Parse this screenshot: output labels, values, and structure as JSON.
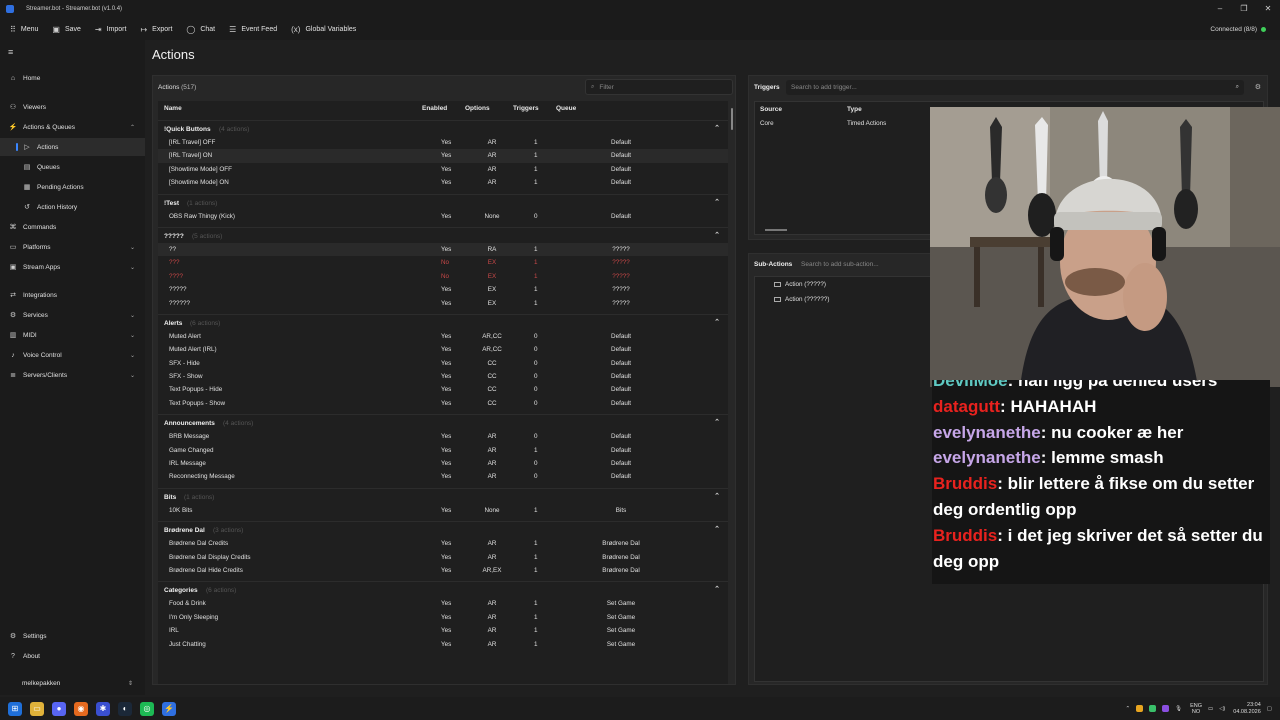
{
  "window": {
    "title": "Streamer.bot - Streamer.bot (v1.0.4)"
  },
  "toolbar": {
    "items": [
      {
        "label": "Menu",
        "icon": "grid-icon"
      },
      {
        "label": "Save",
        "icon": "save-icon"
      },
      {
        "label": "Import",
        "icon": "import-icon"
      },
      {
        "label": "Export",
        "icon": "export-icon"
      },
      {
        "label": "Chat",
        "icon": "chat-icon"
      },
      {
        "label": "Event Feed",
        "icon": "event-feed-icon"
      },
      {
        "label": "Global Variables",
        "icon": "variables-icon"
      }
    ],
    "connection": "Connected (8/8)",
    "connection_color": "#3fcf5a"
  },
  "sidebar": {
    "items": [
      {
        "label": "Home",
        "icon": "home-icon"
      },
      {
        "label": "Viewers",
        "icon": "viewers-icon"
      },
      {
        "label": "Actions & Queues",
        "icon": "actions-icon"
      },
      {
        "label": "Actions",
        "icon": "action-icon"
      },
      {
        "label": "Queues",
        "icon": "queues-icon"
      },
      {
        "label": "Pending Actions",
        "icon": "pending-icon"
      },
      {
        "label": "Action History",
        "icon": "history-icon"
      },
      {
        "label": "Commands",
        "icon": "commands-icon"
      },
      {
        "label": "Platforms",
        "icon": "platforms-icon"
      },
      {
        "label": "Stream Apps",
        "icon": "stream-apps-icon"
      },
      {
        "label": "Integrations",
        "icon": "integrations-icon"
      },
      {
        "label": "Services",
        "icon": "services-icon"
      },
      {
        "label": "MIDI",
        "icon": "midi-icon"
      },
      {
        "label": "Voice Control",
        "icon": "voice-icon"
      },
      {
        "label": "Servers/Clients",
        "icon": "servers-icon"
      },
      {
        "label": "Settings",
        "icon": "settings-icon"
      },
      {
        "label": "About",
        "icon": "about-icon"
      }
    ],
    "user": "melkepakken"
  },
  "page": {
    "title": "Actions"
  },
  "actions_panel": {
    "label": "Actions",
    "count": "(517)",
    "filter_placeholder": "Filter",
    "columns": [
      "Name",
      "Enabled",
      "Options",
      "Triggers",
      "Queue"
    ],
    "groups": [
      {
        "name": "!Quick Buttons",
        "count": "(4 actions)",
        "rows": [
          {
            "name": "[IRL Travel] OFF",
            "enabled": "Yes",
            "options": "AR",
            "triggers": "1",
            "queue": "Default"
          },
          {
            "name": "[IRL Travel] ON",
            "enabled": "Yes",
            "options": "AR",
            "triggers": "1",
            "queue": "Default"
          },
          {
            "name": "[Showtime Mode] OFF",
            "enabled": "Yes",
            "options": "AR",
            "triggers": "1",
            "queue": "Default"
          },
          {
            "name": "[Showtime Mode] ON",
            "enabled": "Yes",
            "options": "AR",
            "triggers": "1",
            "queue": "Default"
          }
        ]
      },
      {
        "name": "!Test",
        "count": "(1 actions)",
        "rows": [
          {
            "name": "OBS Raw Thingy (Kick)",
            "enabled": "Yes",
            "options": "None",
            "triggers": "0",
            "queue": "Default"
          }
        ]
      },
      {
        "name": "?????",
        "count": "(5 actions)",
        "rows": [
          {
            "name": "??",
            "enabled": "Yes",
            "options": "RA",
            "triggers": "1",
            "queue": "?????"
          },
          {
            "name": "???",
            "enabled": "No",
            "options": "EX",
            "triggers": "1",
            "queue": "?????"
          },
          {
            "name": "????",
            "enabled": "No",
            "options": "EX",
            "triggers": "1",
            "queue": "?????"
          },
          {
            "name": "?????",
            "enabled": "Yes",
            "options": "EX",
            "triggers": "1",
            "queue": "?????"
          },
          {
            "name": "??????",
            "enabled": "Yes",
            "options": "EX",
            "triggers": "1",
            "queue": "?????"
          }
        ]
      },
      {
        "name": "Alerts",
        "count": "(6 actions)",
        "rows": [
          {
            "name": "Muted Alert",
            "enabled": "Yes",
            "options": "AR,CC",
            "triggers": "0",
            "queue": "Default"
          },
          {
            "name": "Muted Alert (IRL)",
            "enabled": "Yes",
            "options": "AR,CC",
            "triggers": "0",
            "queue": "Default"
          },
          {
            "name": "SFX - Hide",
            "enabled": "Yes",
            "options": "CC",
            "triggers": "0",
            "queue": "Default"
          },
          {
            "name": "SFX - Show",
            "enabled": "Yes",
            "options": "CC",
            "triggers": "0",
            "queue": "Default"
          },
          {
            "name": "Text Popups - Hide",
            "enabled": "Yes",
            "options": "CC",
            "triggers": "0",
            "queue": "Default"
          },
          {
            "name": "Text Popups - Show",
            "enabled": "Yes",
            "options": "CC",
            "triggers": "0",
            "queue": "Default"
          }
        ]
      },
      {
        "name": "Announcements",
        "count": "(4 actions)",
        "rows": [
          {
            "name": "BRB Message",
            "enabled": "Yes",
            "options": "AR",
            "triggers": "0",
            "queue": "Default"
          },
          {
            "name": "Game Changed",
            "enabled": "Yes",
            "options": "AR",
            "triggers": "1",
            "queue": "Default"
          },
          {
            "name": "IRL Message",
            "enabled": "Yes",
            "options": "AR",
            "triggers": "0",
            "queue": "Default"
          },
          {
            "name": "Reconnecting Message",
            "enabled": "Yes",
            "options": "AR",
            "triggers": "0",
            "queue": "Default"
          }
        ]
      },
      {
        "name": "Bits",
        "count": "(1 actions)",
        "rows": [
          {
            "name": "10K Bits",
            "enabled": "Yes",
            "options": "None",
            "triggers": "1",
            "queue": "Bits"
          }
        ]
      },
      {
        "name": "Brødrene Dal",
        "count": "(3 actions)",
        "rows": [
          {
            "name": "Brødrene Dal Credits",
            "enabled": "Yes",
            "options": "AR",
            "triggers": "1",
            "queue": "Brødrene Dal"
          },
          {
            "name": "Brødrene Dal Display Credits",
            "enabled": "Yes",
            "options": "AR",
            "triggers": "1",
            "queue": "Brødrene Dal"
          },
          {
            "name": "Brødrene Dal Hide Credits",
            "enabled": "Yes",
            "options": "AR,EX",
            "triggers": "1",
            "queue": "Brødrene Dal"
          }
        ]
      },
      {
        "name": "Categories",
        "count": "(6 actions)",
        "rows": [
          {
            "name": "Food & Drink",
            "enabled": "Yes",
            "options": "AR",
            "triggers": "1",
            "queue": "Set Game"
          },
          {
            "name": "I'm Only Sleeping",
            "enabled": "Yes",
            "options": "AR",
            "triggers": "1",
            "queue": "Set Game"
          },
          {
            "name": "IRL",
            "enabled": "Yes",
            "options": "AR",
            "triggers": "1",
            "queue": "Set Game"
          },
          {
            "name": "Just Chatting",
            "enabled": "Yes",
            "options": "AR",
            "triggers": "1",
            "queue": "Set Game"
          }
        ]
      }
    ]
  },
  "triggers_panel": {
    "label": "Triggers",
    "search_placeholder": "Search to add trigger...",
    "columns": [
      "Source",
      "Type"
    ],
    "rows": [
      {
        "source": "Core",
        "type": "Timed Actions"
      }
    ]
  },
  "subactions_panel": {
    "label": "Sub-Actions",
    "search_placeholder": "Search to add sub-action...",
    "items": [
      "Action (?????)",
      "Action (??????)"
    ]
  },
  "chat_overlay": {
    "lines": [
      {
        "user": "DevilMoe",
        "color": "#5fc9c2",
        "text": "nan ligg på denied users"
      },
      {
        "user": "datagutt",
        "color": "#e8221e",
        "text": "HAHAHAH"
      },
      {
        "user": "evelynanethe",
        "color": "#c6a6e8",
        "text": "nu cooker æ her"
      },
      {
        "user": "evelynanethe",
        "color": "#c6a6e8",
        "text": "lemme smash"
      },
      {
        "user": "Bruddis",
        "color": "#e8221e",
        "text": "blir lettere å fikse om du setter deg ordentlig opp"
      },
      {
        "user": "Bruddis",
        "color": "#e8221e",
        "text": "i det jeg skriver det så setter du deg opp"
      }
    ]
  },
  "taskbar": {
    "lang_top": "ENG",
    "lang_bottom": "NO",
    "time": "23:04",
    "date": "04.08.2026"
  }
}
